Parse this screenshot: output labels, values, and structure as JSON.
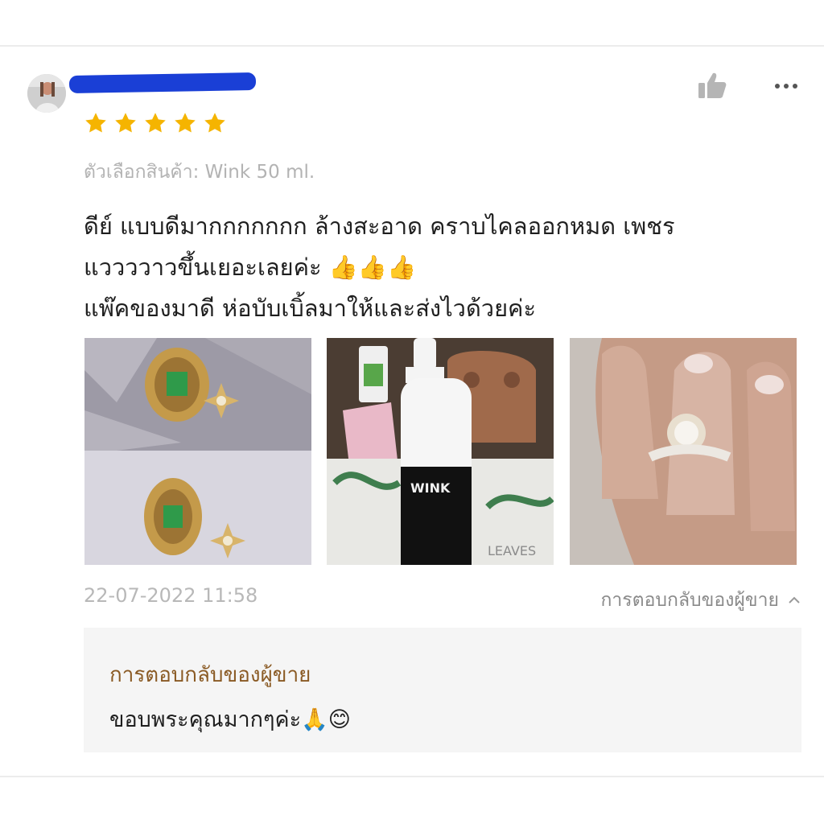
{
  "review": {
    "rating": 5,
    "variant_label": "ตัวเลือกสินค้า: Wink 50 ml.",
    "text_lines": [
      "ดีย์ แบบดีมากกกกกกก ล้างสะอาด คราบไคลออกหมด เพชร",
      "แววววาวขึ้นเยอะเลยค่ะ 👍👍👍",
      "แพ๊คของมาดี ห่อบับเบิ้ลมาให้และส่งไวด้วยค่ะ"
    ],
    "timestamp": "22-07-2022 11:58",
    "photo_label_wink": "WINK",
    "photo_label_leaves": "LEAVES"
  },
  "seller_reply": {
    "toggle_label": "การตอบกลับของผู้ขาย",
    "title": "การตอบกลับของผู้ขาย",
    "text": "ขอบพระคุณมากๆค่ะ🙏😊"
  },
  "icons": {
    "like": "thumbs-up-icon",
    "more": "more-horizontal-icon",
    "star": "star-icon",
    "toggle": "chevron-up-icon"
  },
  "colors": {
    "star": "#f5b400",
    "seller_title": "#8a5a24",
    "redaction": "#1a3fd6"
  }
}
